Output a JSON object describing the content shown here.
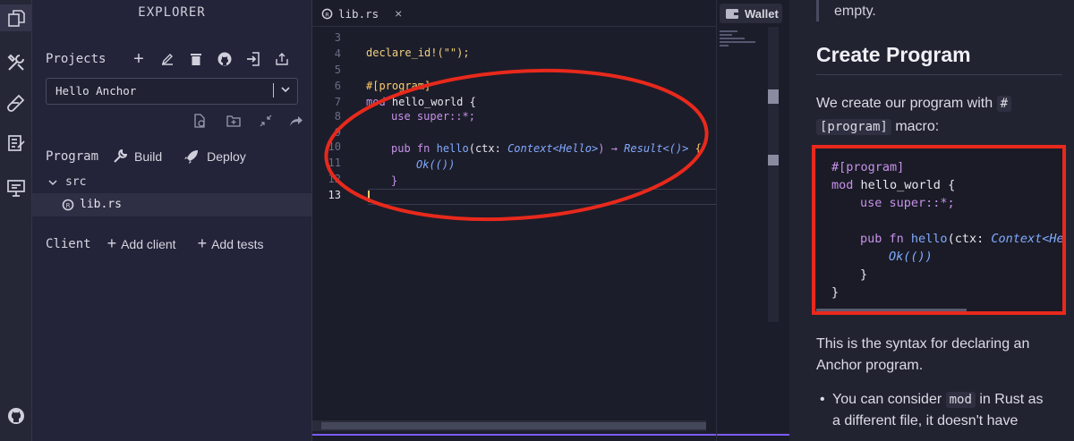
{
  "explorer": {
    "title": "EXPLORER",
    "projects_label": "Projects",
    "project_selected": "Hello Anchor",
    "program_label": "Program",
    "build_label": "Build",
    "deploy_label": "Deploy",
    "folder": "src",
    "file": "lib.rs",
    "client_label": "Client",
    "add_client_label": "Add client",
    "add_tests_label": "Add tests"
  },
  "editor": {
    "tab_label": "lib.rs",
    "line_numbers": [
      "3",
      "4",
      "5",
      "6",
      "7",
      "8",
      "9",
      "10",
      "11",
      "12",
      "13"
    ],
    "code": {
      "l4": "declare_id!(\"\");",
      "l6_attr": "#[program]",
      "l7_kw": "mod",
      "l7_name": "hello_world {",
      "l8_kw": "use",
      "l8_rest": "super::*;",
      "l10_kw": "pub fn",
      "l10_fn": "hello",
      "l10_args": "(ctx:",
      "l10_type": "Context<Hello>",
      "l10_arrow": ") →",
      "l10_ret": "Result<()>",
      "l10_end": "{",
      "l11": "Ok(())",
      "l12": "}"
    }
  },
  "wallet": {
    "label": "Wallet"
  },
  "docs": {
    "top_text": "empty.",
    "heading": "Create Program",
    "para1_a": "We create our program with",
    "para1_hash": "#",
    "para1_code": "[program]",
    "para1_b": "macro:",
    "codeblock": {
      "l1": "#[program]",
      "l2_kw": "mod",
      "l2_rest": "hello_world {",
      "l3_kw": "use",
      "l3_rest": "super::*;",
      "l5_kw": "pub fn",
      "l5_fn": "hello",
      "l5_args": "(ctx:",
      "l5_type": "Context<Hel",
      "l6": "Ok(())",
      "l7": "}",
      "l8": "}"
    },
    "para2": "This is the syntax for declaring an Anchor program.",
    "bullet_a": "You can consider",
    "bullet_code": "mod",
    "bullet_b": "in Rust as",
    "bullet_c": "a different file, it doesn't have"
  },
  "colors": {
    "accent_purple": "#7c5cff",
    "annotation_red": "#e8291c",
    "keyword": "#c792ea",
    "type_italic": "#82aaff",
    "string": "#c3e88d"
  }
}
